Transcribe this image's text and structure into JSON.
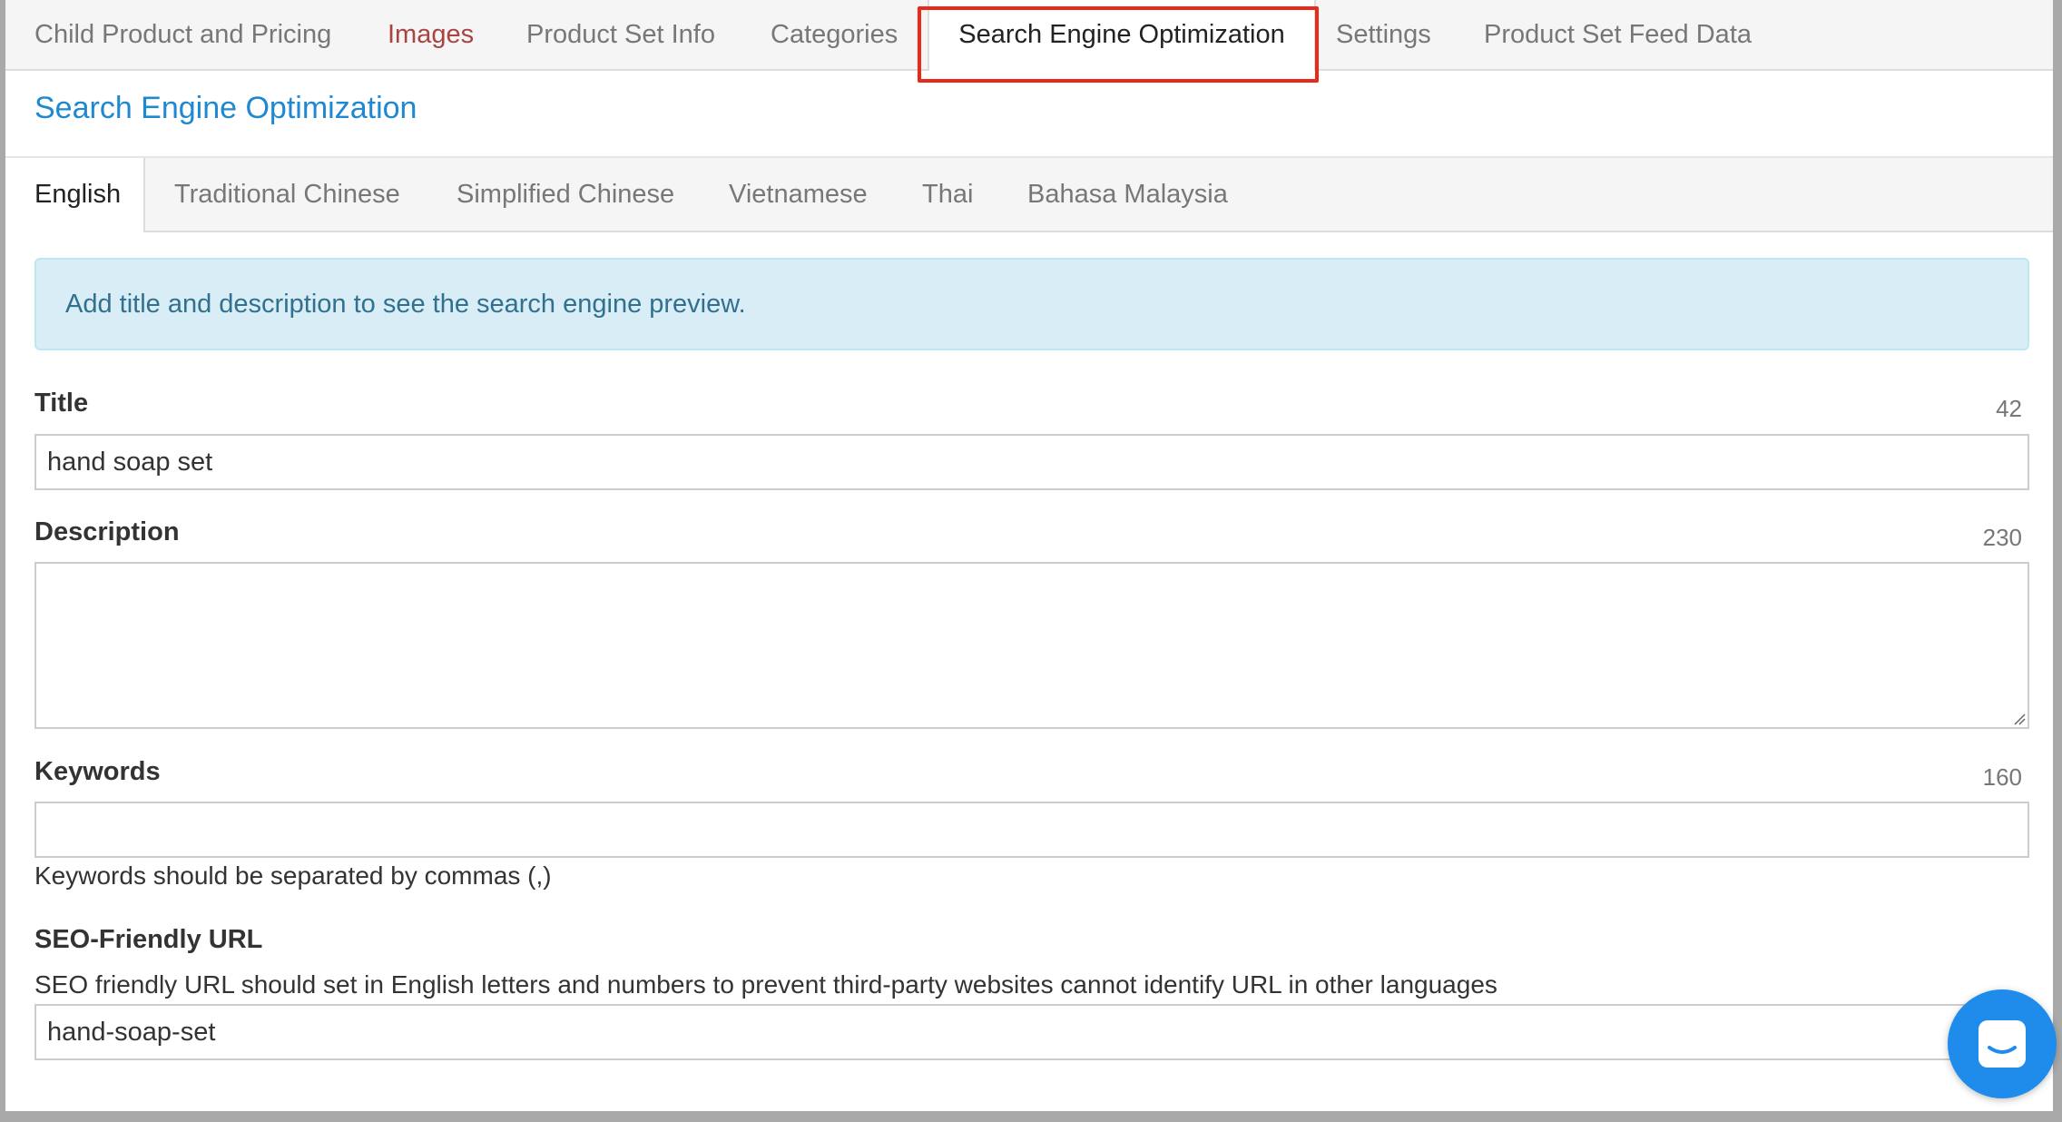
{
  "top_tabs": [
    {
      "label": "Child Product and Pricing"
    },
    {
      "label": "Images"
    },
    {
      "label": "Product Set Info"
    },
    {
      "label": "Categories"
    },
    {
      "label": "Search Engine Optimization"
    },
    {
      "label": "Settings"
    },
    {
      "label": "Product Set Feed Data"
    }
  ],
  "section_title": "Search Engine Optimization",
  "language_tabs": [
    {
      "label": "English"
    },
    {
      "label": "Traditional Chinese"
    },
    {
      "label": "Simplified Chinese"
    },
    {
      "label": "Vietnamese"
    },
    {
      "label": "Thai"
    },
    {
      "label": "Bahasa Malaysia"
    }
  ],
  "alert": {
    "text": "Add title and description to see the search engine preview."
  },
  "fields": {
    "title": {
      "label": "Title",
      "counter": "42",
      "value": "hand soap set"
    },
    "description": {
      "label": "Description",
      "counter": "230",
      "value": ""
    },
    "keywords": {
      "label": "Keywords",
      "counter": "160",
      "value": "",
      "help": "Keywords should be separated by commas (,)"
    },
    "seo_url": {
      "label": "SEO-Friendly URL",
      "help": "SEO friendly URL should set in English letters and numbers to prevent third-party websites cannot identify URL in other languages",
      "value": "hand-soap-set"
    }
  },
  "colors": {
    "link_blue": "#1e88d0",
    "error_red": "#a94442",
    "highlight_red": "#e8291c",
    "alert_bg": "#d9edf7",
    "chat_blue": "#1f8ceb"
  },
  "chat": {
    "icon": "chat-bubble-icon"
  }
}
